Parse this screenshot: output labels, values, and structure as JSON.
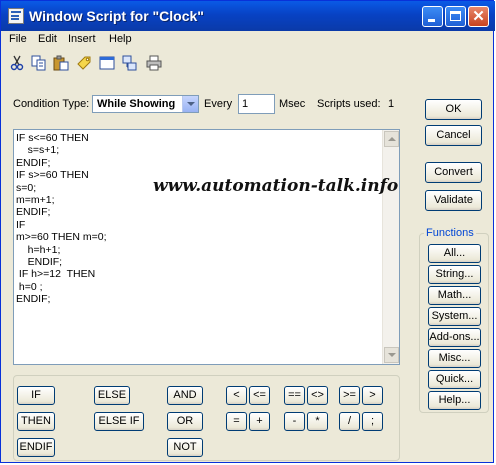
{
  "window": {
    "title": "Window Script for \"Clock\""
  },
  "menu": [
    "File",
    "Edit",
    "Insert",
    "Help"
  ],
  "toolbar": [
    "cut-icon",
    "copy-icon",
    "paste-icon",
    "tag-icon",
    "window-icon",
    "network-icon",
    "print-icon"
  ],
  "condition": {
    "label": "Condition Type:",
    "value": "While Showing",
    "every_label": "Every",
    "every_value": "1",
    "msec_label": "Msec",
    "scripts_used_label": "Scripts used:",
    "scripts_used_value": "1"
  },
  "script": {
    "text": "IF s<=60 THEN\n    s=s+1;\nENDIF;\nIF s>=60 THEN\ns=0;\nm=m+1;\nENDIF;\nIF\nm>=60 THEN m=0;\n    h=h+1;\n    ENDIF;\n IF h>=12  THEN\n h=0 ;\nENDIF;"
  },
  "watermark": "www.automation-talk.info",
  "right_buttons": {
    "ok": "OK",
    "cancel": "Cancel",
    "convert": "Convert",
    "validate": "Validate"
  },
  "functions": {
    "label": "Functions",
    "items": [
      "All...",
      "String...",
      "Math...",
      "System...",
      "Add-ons...",
      "Misc...",
      "Quick...",
      "Help..."
    ]
  },
  "keypad": {
    "if": "IF",
    "then": "THEN",
    "endif": "ENDIF",
    "else": "ELSE",
    "elseif": "ELSE IF",
    "and": "AND",
    "or": "OR",
    "not": "NOT",
    "lt": "<",
    "le": "<=",
    "eq": "==",
    "ne": "<>",
    "ge": ">=",
    "gt": ">",
    "assign": "=",
    "plus": "+",
    "minus": "-",
    "times": "*",
    "divide": "/",
    "semicolon": ";"
  }
}
